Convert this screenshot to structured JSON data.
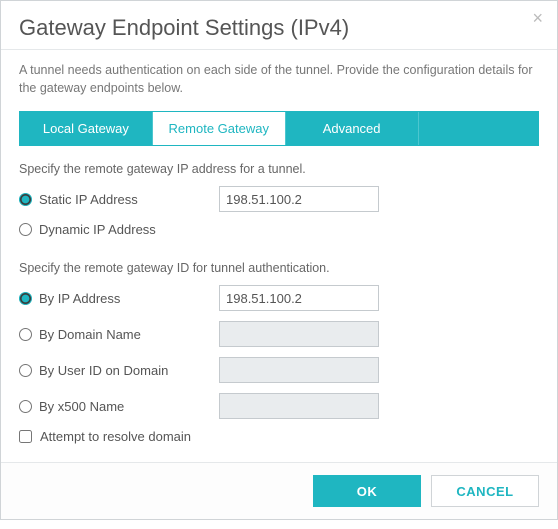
{
  "header": {
    "title": "Gateway Endpoint Settings (IPv4)",
    "close_glyph": "×"
  },
  "description": "A tunnel needs authentication on each side of the tunnel. Provide the configuration details for the gateway endpoints below.",
  "tabs": {
    "local": "Local Gateway",
    "remote": "Remote Gateway",
    "advanced": "Advanced",
    "active": "remote"
  },
  "ip_section": {
    "label": "Specify the remote gateway IP address for a tunnel.",
    "static_label": "Static IP Address",
    "static_value": "198.51.100.2",
    "dynamic_label": "Dynamic IP Address",
    "selected": "static"
  },
  "id_section": {
    "label": "Specify the remote gateway ID for tunnel authentication.",
    "by_ip_label": "By IP Address",
    "by_ip_value": "198.51.100.2",
    "by_domain_label": "By Domain Name",
    "by_domain_value": "",
    "by_userid_label": "By User ID on Domain",
    "by_userid_value": "",
    "by_x500_label": "By x500 Name",
    "by_x500_value": "",
    "selected": "by_ip",
    "resolve_label": "Attempt to resolve domain",
    "resolve_checked": false
  },
  "footer": {
    "ok": "OK",
    "cancel": "CANCEL"
  }
}
